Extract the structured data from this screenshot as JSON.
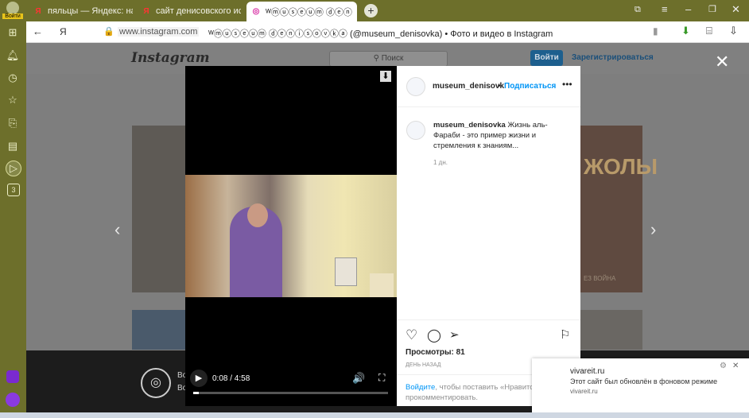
{
  "browser": {
    "profile_label": "Войти",
    "tabs": [
      {
        "title": "пяльцы — Яндекс: нашлось"
      },
      {
        "title": "сайт денисовского истори"
      },
      {
        "title": "ᵂⓜⓤⓢⓔⓤⓜ ⓓⓔⓝ"
      }
    ],
    "address": {
      "domain": "www.instagram.com",
      "title": "ᵂⓜⓤⓢⓔⓤⓜ ⓓⓔⓝⓘⓢⓞⓥⓚⓐ (@museum_denisovka) • Фото и видео в Instagram"
    },
    "sidebar_badge": "3"
  },
  "instagram": {
    "logo": "Instagram",
    "search_placeholder": "Поиск",
    "login_label": "Войти",
    "signup_label": "Зарегистрироваться",
    "bg_poster_text": "ЖОЛЫ",
    "bg_poster_sub": "ЕЗ ВОЙНА"
  },
  "video": {
    "time": "0:08 / 4:58",
    "progress": 0.028
  },
  "post": {
    "username": "museum_denisovk",
    "follow_label": "Подписаться",
    "caption_user": "museum_denisovka",
    "caption_text": "Жизнь аль-Фараби - это пример жизни и стремления к знаниям...",
    "caption_age": "1 дн.",
    "views": "Просмотры: 81",
    "age": "ДЕНЬ НАЗАД",
    "login_link": "Войдите",
    "login_prompt": ", чтобы поставить «Нравится» или прокомментировать."
  },
  "bottom_banner": {
    "line1": "Во",
    "line2": "Во"
  },
  "notification": {
    "site": "vivareit.ru",
    "message": "Этот сайт был обновлён в фоновом режиме",
    "domain": "vivareit.ru"
  }
}
